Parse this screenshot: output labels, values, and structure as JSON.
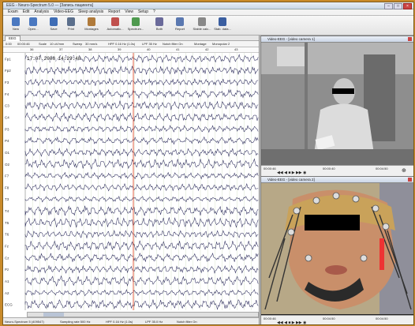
{
  "window": {
    "title": "EEG - Neuro-Spectrum 5.0 — [Запись пациента]"
  },
  "menu": [
    "Exam",
    "Edit",
    "Analysis",
    "Video-EEG",
    "Sleep analysis",
    "Report",
    "View",
    "Setup",
    "?"
  ],
  "toolbar": [
    {
      "label": "New",
      "icon": "new-exam-icon",
      "color": "#4a78c0"
    },
    {
      "label": "Open...",
      "icon": "open-folder-icon",
      "color": "#4a78c0"
    },
    {
      "label": "Save",
      "icon": "save-icon",
      "color": "#3f6db5"
    },
    {
      "label": "Print",
      "icon": "print-icon",
      "color": "#5b6f8c"
    },
    {
      "label": "Montages",
      "icon": "montage-icon",
      "color": "#b07a3a"
    },
    {
      "label": "Automatic...",
      "icon": "auto-analysis-icon",
      "color": "#c0504d"
    },
    {
      "label": "Spectrum...",
      "icon": "spectrum-icon",
      "color": "#4f9a4f"
    },
    {
      "label": "Both",
      "icon": "both-icon",
      "color": "#6a6a9a"
    },
    {
      "label": "Report",
      "icon": "report-icon",
      "color": "#5a78b0"
    },
    {
      "label": "Stable calc...",
      "icon": "stable-calc-icon",
      "color": "#888888"
    },
    {
      "label": "Stab. data...",
      "icon": "stab-data-icon",
      "color": "#3a5ea0"
    }
  ],
  "eeg": {
    "tab": "EEG",
    "controls": {
      "t0": "0:00",
      "t1": "00:00:46",
      "scale_label": "Scale",
      "scale_value": "10 uV/mm",
      "sweep_label": "Sweep",
      "sweep_value": "30 mm/s",
      "hpf": "HPF 0.16 Hz (1.0s)",
      "lpf": "LPF 35 Hz",
      "notch": "Notch filter On",
      "montage_label": "Montage",
      "montage_value": "Monopolar 2"
    },
    "time_ticks": [
      "36",
      "37",
      "38",
      "39",
      "40",
      "41",
      "42",
      "43"
    ],
    "timestamp": "17.07.2008 14:29:48",
    "channels": [
      "Fp1",
      "Fp2",
      "F3",
      "F4",
      "C3",
      "C4",
      "P3",
      "P4",
      "O1",
      "O2",
      "F7",
      "F8",
      "T3",
      "T4",
      "T5",
      "T6",
      "Fz",
      "Cz",
      "Pz",
      "A1",
      "A2",
      "ECG"
    ],
    "colors": {
      "trace": "#2a2a5a",
      "grid": "#d8e4cc",
      "marker": "#e05030"
    }
  },
  "status": {
    "items": [
      "Neuro-Spectrum 5 (409547)",
      "Sampling rate 500 Hz",
      "HPF 0.16 Hz (1.0s)",
      "LPF 35.0 Hz",
      "Notch filter On"
    ]
  },
  "video1": {
    "title": "Video-EEG - [video camera 1]",
    "time_left": "00:00:46",
    "time_mid": "00:00:40",
    "time_right": "00:04:50"
  },
  "video2": {
    "title": "Video-EEG - [video camera 2]",
    "time_left": "00:00:46",
    "time_mid": "00:04:50",
    "time_right": "00:04:50"
  }
}
